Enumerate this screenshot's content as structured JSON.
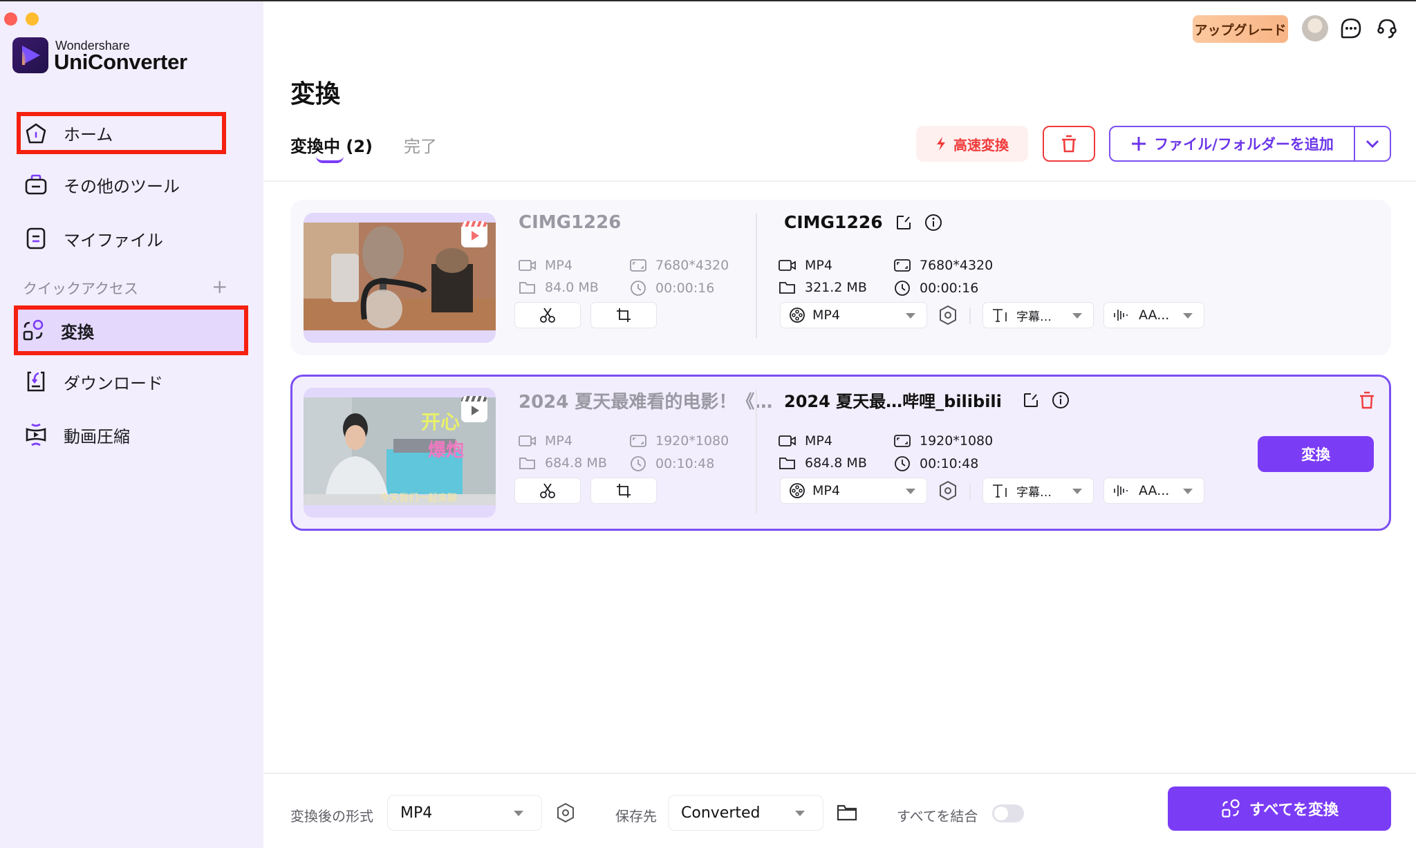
{
  "app": {
    "brand_small": "Wondershare",
    "brand_name": "UniConverter"
  },
  "sidebar": {
    "items": [
      {
        "label": "ホーム",
        "icon": "home-icon"
      },
      {
        "label": "その他のツール",
        "icon": "toolbox-icon"
      },
      {
        "label": "マイファイル",
        "icon": "my-files-icon"
      }
    ],
    "quick_access_label": "クイックアクセス",
    "quick_access_add": "+",
    "quick_items": [
      {
        "label": "変換",
        "icon": "convert-icon",
        "active": true
      },
      {
        "label": "ダウンロード",
        "icon": "download-icon"
      },
      {
        "label": "動画圧縮",
        "icon": "compress-icon"
      }
    ]
  },
  "header": {
    "upgrade_label": "アップグレード",
    "icons": [
      "avatar",
      "chat-icon",
      "headset-icon"
    ]
  },
  "main": {
    "title": "変換",
    "tabs": [
      {
        "label": "変換中 (2)",
        "active": true
      },
      {
        "label": "完了",
        "active": false
      }
    ],
    "toolbar": {
      "fast_convert_label": "高速変換",
      "add_files_label": "ファイル/フォルダーを追加"
    },
    "files": [
      {
        "source": {
          "title": "CIMG1226",
          "format": "MP4",
          "size": "84.0 MB",
          "resolution": "7680*4320",
          "duration": "00:00:16"
        },
        "output": {
          "title": "CIMG1226",
          "format": "MP4",
          "size": "321.2 MB",
          "resolution": "7680*4320",
          "duration": "00:00:16"
        },
        "format_select": "MP4",
        "subtitle_select": "字幕…",
        "audio_select": "AA...",
        "selected": false
      },
      {
        "source": {
          "title": "2024 夏天最难看的电影！《…",
          "format": "MP4",
          "size": "684.8 MB",
          "resolution": "1920*1080",
          "duration": "00:10:48"
        },
        "output": {
          "title": "2024 夏天最…哔哩_bilibili",
          "format": "MP4",
          "size": "684.8 MB",
          "resolution": "1920*1080",
          "duration": "00:10:48"
        },
        "format_select": "MP4",
        "subtitle_select": "字幕…",
        "audio_select": "AA...",
        "convert_label": "変換",
        "selected": true
      }
    ]
  },
  "bottom": {
    "format_label": "変換後の形式",
    "format_value": "MP4",
    "save_label": "保存先",
    "save_value": "Converted",
    "merge_label": "すべてを結合",
    "merge_enabled": false,
    "convert_all_label": "すべてを変換"
  },
  "colors": {
    "accent": "#7b3cf6",
    "danger": "#ef3a3a",
    "sidebar_bg": "#f2eefd",
    "highlight_box": "#f5200f"
  }
}
